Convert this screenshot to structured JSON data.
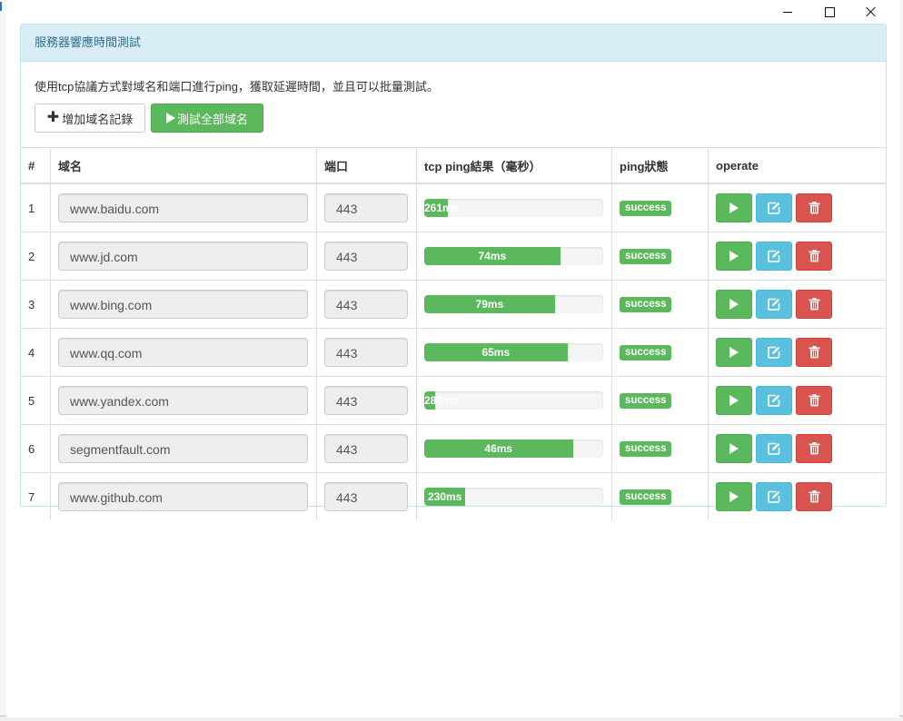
{
  "window": {
    "controls": {
      "minimize": "minimize-icon",
      "maximize": "maximize-icon",
      "close": "close-icon"
    }
  },
  "panel": {
    "title": "服務器響應時間測試",
    "description": "使用tcp協議方式對域名和端口進行ping，獲取延遲時間，並且可以批量測試。",
    "add_button": "增加域名記錄",
    "test_all_button": "測試全部域名"
  },
  "table": {
    "headers": [
      "#",
      "域名",
      "端口",
      "tcp ping結果（毫秒）",
      "ping狀態",
      "operate"
    ],
    "rows": [
      {
        "index": "1",
        "domain": "www.baidu.com",
        "port": "443",
        "result": "261ms",
        "fill": 0.13,
        "status": "success"
      },
      {
        "index": "2",
        "domain": "www.jd.com",
        "port": "443",
        "result": "74ms",
        "fill": 0.76,
        "status": "success"
      },
      {
        "index": "3",
        "domain": "www.bing.com",
        "port": "443",
        "result": "79ms",
        "fill": 0.73,
        "status": "success"
      },
      {
        "index": "4",
        "domain": "www.qq.com",
        "port": "443",
        "result": "65ms",
        "fill": 0.8,
        "status": "success"
      },
      {
        "index": "5",
        "domain": "www.yandex.com",
        "port": "443",
        "result": "288ms",
        "fill": 0.06,
        "status": "success"
      },
      {
        "index": "6",
        "domain": "segmentfault.com",
        "port": "443",
        "result": "46ms",
        "fill": 0.83,
        "status": "success"
      },
      {
        "index": "7",
        "domain": "www.github.com",
        "port": "443",
        "result": "230ms",
        "fill": 0.23,
        "status": "success"
      }
    ]
  },
  "colors": {
    "success": "#5cb85c",
    "info": "#5bc0de",
    "danger": "#d9534f",
    "panel_heading_bg": "#d9edf7",
    "panel_heading_text": "#31708f"
  }
}
